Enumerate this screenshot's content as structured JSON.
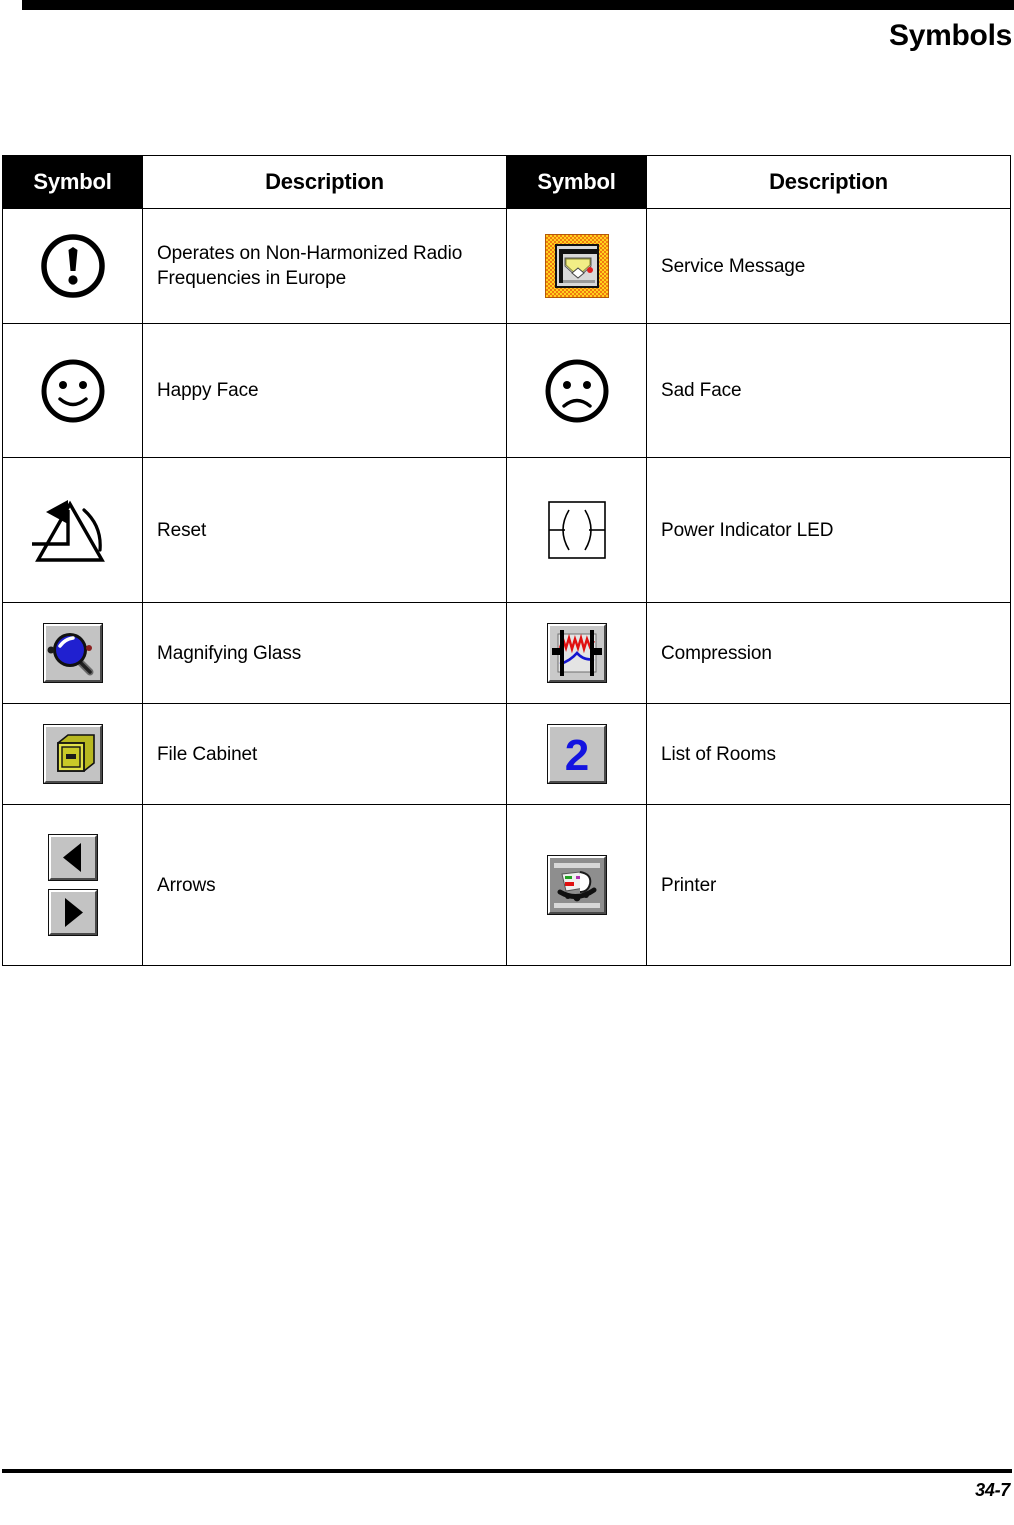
{
  "page": {
    "header_title": "Symbols",
    "page_number": "34-7"
  },
  "table": {
    "headers": {
      "symbol_left": "Symbol",
      "description_left": "Description",
      "symbol_right": "Symbol",
      "description_right": "Description"
    },
    "rows": [
      {
        "left": {
          "icon": "exclamation-in-circle-icon",
          "description": "Operates on Non-Harmonized Radio Frequencies in Europe"
        },
        "right": {
          "icon": "service-message-icon",
          "description": "Service Message"
        }
      },
      {
        "left": {
          "icon": "happy-face-icon",
          "description": "Happy Face"
        },
        "right": {
          "icon": "sad-face-icon",
          "description": "Sad Face"
        }
      },
      {
        "left": {
          "icon": "reset-triangle-arrow-icon",
          "description": "Reset"
        },
        "right": {
          "icon": "power-indicator-led-icon",
          "description": "Power Indicator LED"
        }
      },
      {
        "left": {
          "icon": "magnifying-glass-icon",
          "description": "Magnifying Glass"
        },
        "right": {
          "icon": "compression-icon",
          "description": "Compression"
        }
      },
      {
        "left": {
          "icon": "file-cabinet-icon",
          "description": "File Cabinet"
        },
        "right": {
          "icon": "list-of-rooms-icon",
          "description": "List of Rooms"
        }
      },
      {
        "left": {
          "icon": "arrows-icon",
          "description": "Arrows"
        },
        "right": {
          "icon": "printer-icon",
          "description": "Printer"
        }
      }
    ]
  },
  "colors": {
    "header_background": "#000000",
    "header_text": "#ffffff",
    "border": "#000000",
    "service_message_accent": "#f07a10",
    "magnifier_lens": "#2020d0",
    "file_cabinet": "#d8d840",
    "list_of_rooms_digit": "#1414e0",
    "compression_wave_top": "#e01010",
    "compression_wave_bottom": "#1414d0",
    "button_face": "#c3c3c3"
  }
}
